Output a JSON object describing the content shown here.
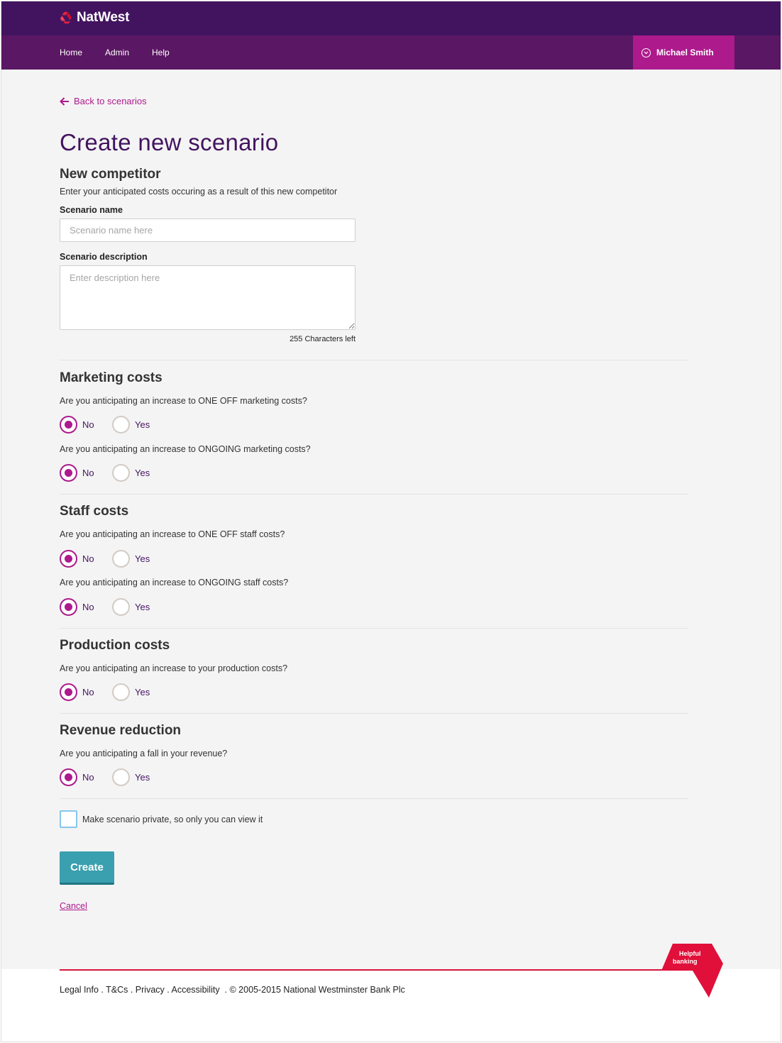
{
  "brand": {
    "name": "NatWest",
    "logo_icon": "natwest-chevrons-icon",
    "accent": "#ad1a8c",
    "header_bg": "#42145f",
    "nav_bg": "#5a1763"
  },
  "nav": {
    "items": [
      {
        "label": "Home"
      },
      {
        "label": "Admin"
      },
      {
        "label": "Help"
      }
    ],
    "user": {
      "name": "Michael Smith",
      "icon": "chevron-down-circle-icon"
    }
  },
  "back_link": {
    "label": "Back to scenarios",
    "icon": "arrow-left-icon"
  },
  "page": {
    "title": "Create new scenario",
    "subtitle": "New competitor",
    "intro": "Enter your anticipated costs occuring as a result of this new competitor"
  },
  "form": {
    "name": {
      "label": "Scenario name",
      "placeholder": "Scenario name here",
      "value": ""
    },
    "description": {
      "label": "Scenario description",
      "placeholder": "Enter description here",
      "value": ""
    },
    "chars_left": "255 Characters left",
    "options": {
      "no": "No",
      "yes": "Yes"
    },
    "sections": [
      {
        "title": "Marketing costs",
        "questions": [
          {
            "text": "Are you anticipating an increase to ONE OFF marketing costs?",
            "selected": "No"
          },
          {
            "text": "Are you anticipating an increase to ONGOING marketing costs?",
            "selected": "No"
          }
        ]
      },
      {
        "title": "Staff costs",
        "questions": [
          {
            "text": "Are you anticipating an increase to ONE OFF staff costs?",
            "selected": "No"
          },
          {
            "text": "Are you anticipating an increase to ONGOING staff costs?",
            "selected": "No"
          }
        ]
      },
      {
        "title": "Production costs",
        "questions": [
          {
            "text": "Are you anticipating an increase to your production costs?",
            "selected": "No"
          }
        ]
      },
      {
        "title": "Revenue reduction",
        "questions": [
          {
            "text": "Are you anticipating a fall in your revenue?",
            "selected": "No"
          }
        ]
      }
    ],
    "private_checkbox": {
      "label": "Make scenario private, so only you can view it",
      "checked": false
    },
    "create_label": "Create",
    "cancel_label": "Cancel"
  },
  "footer": {
    "links": [
      "Legal Info",
      "T&Cs",
      "Privacy",
      "Accessibility"
    ],
    "separator": " . ",
    "copyright": "© 2005-2015 National Westminster Bank Plc",
    "badge": {
      "line1": "Helpful",
      "line2": "banking",
      "color": "#e0103a"
    }
  }
}
